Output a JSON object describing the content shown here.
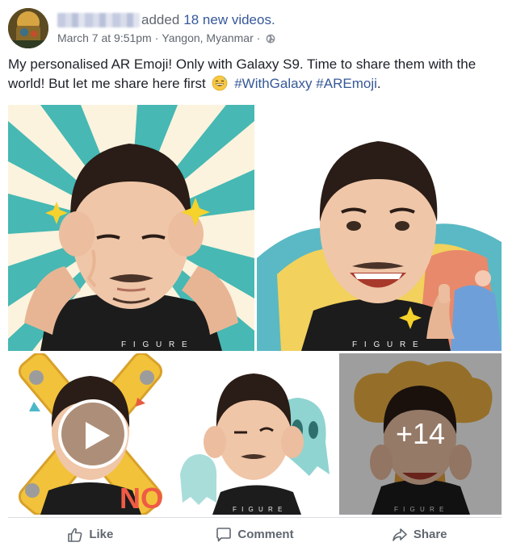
{
  "post": {
    "author_hidden": "",
    "action_text": "added",
    "count_link": "18 new videos.",
    "date": "March 7 at 9:51pm",
    "separator": "·",
    "location": "Yangon, Myanmar",
    "privacy_icon": "globe-icon",
    "caption": {
      "text": "My personalised AR Emoji! Only with Galaxy S9. Time to share them with the world! But let me share here first",
      "emoji": "grinning-sweat-emoji",
      "hashtag1": "#WithGalaxy",
      "hashtag2": "#AREmoji",
      "end": "."
    }
  },
  "media": {
    "overflow_count": "+14",
    "play_icon": "play-icon",
    "tiles": [
      "emoji-ears-sparkle",
      "emoji-rainbow-thumbsup",
      "emoji-no-sign-video",
      "emoji-ghost-scared",
      "emoji-explosion"
    ]
  },
  "actions": {
    "like": "Like",
    "comment": "Comment",
    "share": "Share"
  },
  "colors": {
    "link": "#365899",
    "meta": "#606770",
    "text": "#1d2129",
    "divider": "#dadde1"
  }
}
